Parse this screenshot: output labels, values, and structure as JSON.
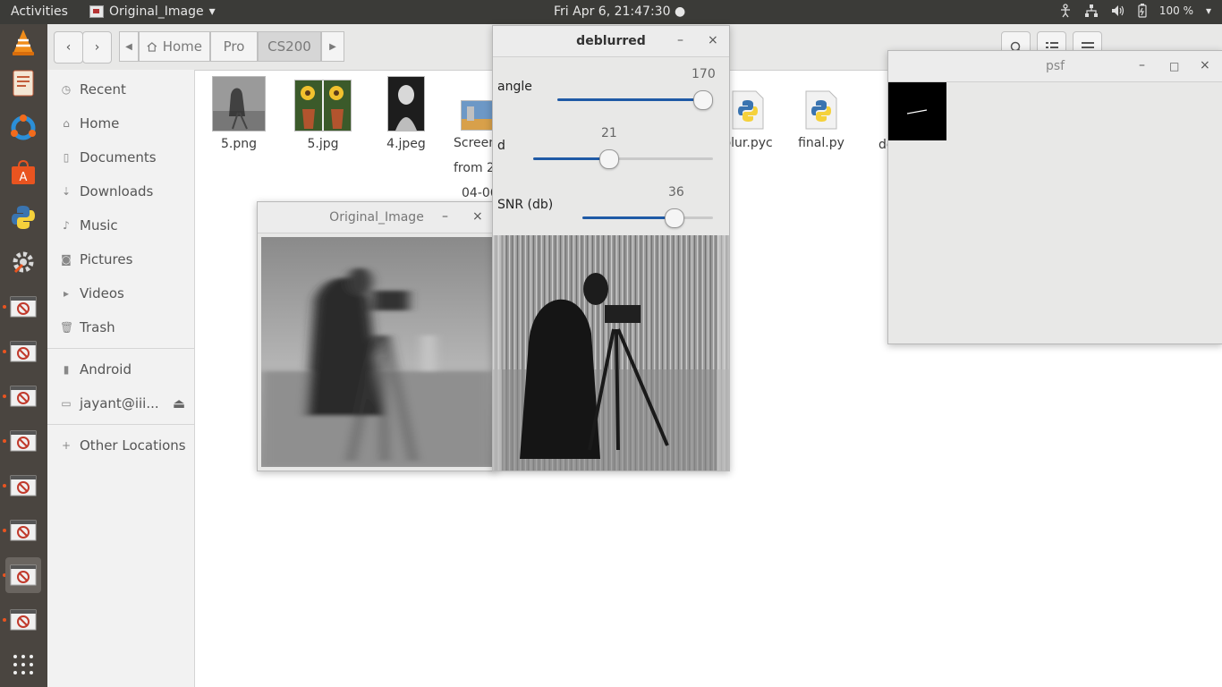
{
  "topbar": {
    "activities": "Activities",
    "app_name": "Original_Image",
    "clock": "Fri Apr  6, 21:47:30",
    "battery": "100 %"
  },
  "nav": {
    "breadcrumbs": [
      "Home",
      "Pro",
      "CS200"
    ]
  },
  "sidebar": {
    "places": [
      "Recent",
      "Home",
      "Documents",
      "Downloads",
      "Music",
      "Pictures",
      "Videos",
      "Trash"
    ],
    "devices": [
      "Android",
      "jayant@iii..."
    ],
    "other": "Other Locations"
  },
  "files": [
    {
      "name": "5.png",
      "line2": "",
      "line3": ""
    },
    {
      "name": "5.jpg",
      "line2": "",
      "line3": ""
    },
    {
      "name": "4.jpeg",
      "line2": "",
      "line3": ""
    },
    {
      "name": "Screen",
      "line2": "from 2",
      "line3": "04-06"
    },
    {
      "name": "blur.pyc",
      "line2": "",
      "line3": ""
    },
    {
      "name": "final.py",
      "line2": "",
      "line3": ""
    },
    {
      "name": "de",
      "line2": "",
      "line3": ""
    }
  ],
  "windows": {
    "original": {
      "title": "Original_Image"
    },
    "deblurred": {
      "title": "deblurred",
      "sliders": [
        {
          "label": "angle",
          "value": 170,
          "level": 1.0
        },
        {
          "label": "d",
          "value": 21,
          "level": 0.42
        },
        {
          "label": "SNR (db)",
          "value": 36,
          "level": 0.7
        }
      ]
    },
    "psf": {
      "title": "psf"
    }
  },
  "icons": [
    "search-icon",
    "view-toggle-icon",
    "menu-icon",
    "minimize-icon",
    "maximize-icon",
    "close-icon"
  ]
}
